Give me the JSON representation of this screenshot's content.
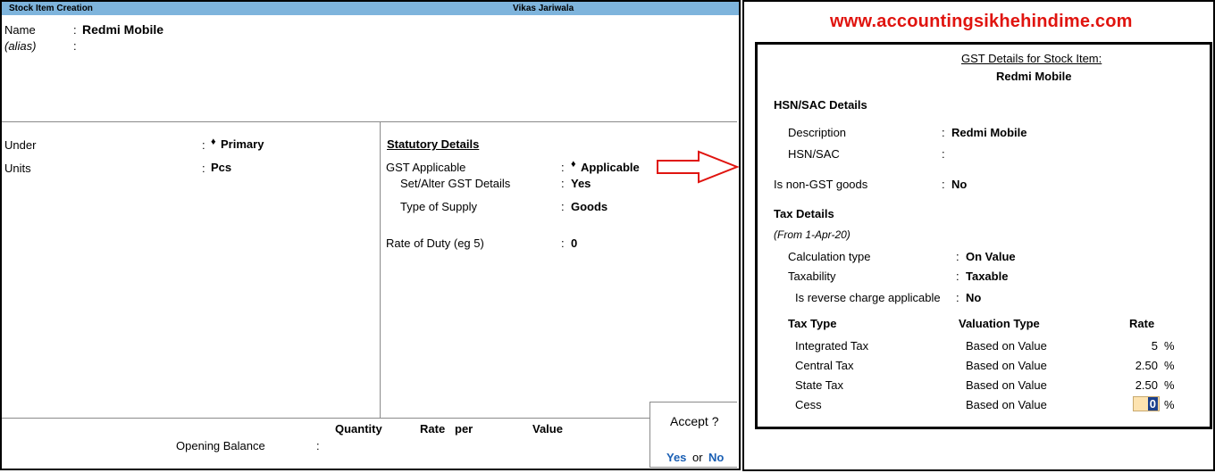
{
  "tally": {
    "title_left": "Stock Item Creation",
    "title_right": "Vikas Jariwala",
    "name_label": "Name",
    "name_sep": ":",
    "name_value": "Redmi Mobile",
    "alias_label": "(alias)",
    "alias_sep": ":",
    "under_label": "Under",
    "under_sep": ":",
    "under_value": "Primary",
    "units_label": "Units",
    "units_sep": ":",
    "units_value": "Pcs",
    "statutory_heading": "Statutory Details",
    "gst_applicable_label": "GST Applicable",
    "gst_applicable_sep": ":",
    "gst_applicable_value": "Applicable",
    "set_alter_label": "Set/Alter GST Details",
    "set_alter_sep": ":",
    "set_alter_value": "Yes",
    "supply_type_label": "Type of Supply",
    "supply_type_sep": ":",
    "supply_type_value": "Goods",
    "rate_duty_label": "Rate of Duty (eg 5)",
    "rate_duty_sep": ":",
    "rate_duty_value": "0",
    "col_quantity": "Quantity",
    "col_rate": "Rate",
    "col_per": "per",
    "col_value": "Value",
    "opening_balance_label": "Opening Balance",
    "opening_balance_sep": ":",
    "diamond": "♦"
  },
  "accept": {
    "question": "Accept ?",
    "yes": "Yes",
    "or": "or",
    "no": "No"
  },
  "website": "www.accountingsikhehindime.com",
  "gst": {
    "heading": "GST Details for Stock Item:",
    "item_name": "Redmi Mobile",
    "hsn_section": "HSN/SAC Details",
    "description_label": "Description",
    "description_sep": ":",
    "description_value": "Redmi Mobile",
    "hsn_label": "HSN/SAC",
    "hsn_sep": ":",
    "non_gst_label": "Is non-GST goods",
    "non_gst_sep": ":",
    "non_gst_value": "No",
    "tax_section": "Tax Details",
    "from_date": "(From 1-Apr-20)",
    "calc_type_label": "Calculation type",
    "calc_type_sep": ":",
    "calc_type_value": "On Value",
    "taxability_label": "Taxability",
    "taxability_sep": ":",
    "taxability_value": "Taxable",
    "reverse_charge_label": "Is reverse charge applicable",
    "reverse_charge_sep": ":",
    "reverse_charge_value": "No",
    "col_tax_type": "Tax Type",
    "col_valuation_type": "Valuation Type",
    "col_rate": "Rate",
    "rows": [
      {
        "tax_type": "Integrated Tax",
        "valuation": "Based on Value",
        "rate": "5",
        "unit": "%"
      },
      {
        "tax_type": "Central Tax",
        "valuation": "Based on Value",
        "rate": "2.50",
        "unit": "%"
      },
      {
        "tax_type": "State Tax",
        "valuation": "Based on Value",
        "rate": "2.50",
        "unit": "%"
      },
      {
        "tax_type": "Cess",
        "valuation": "Based on Value",
        "rate": "0",
        "unit": "%"
      }
    ]
  },
  "colors": {
    "titlebar": "#7eb4dc",
    "website_red": "#e0140f",
    "arrow_red": "#e0140f",
    "accept_blue": "#1a5fb4",
    "input_highlight": "#fde3b0"
  }
}
